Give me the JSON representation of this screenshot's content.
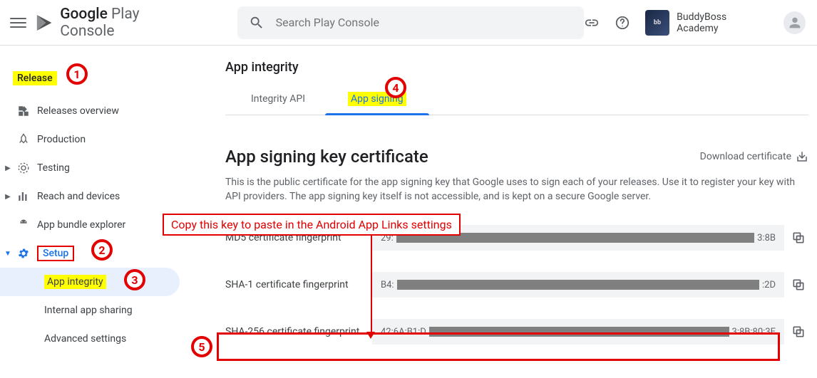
{
  "header": {
    "logo_google": "Google",
    "logo_play": " Play ",
    "logo_console": "Console",
    "search_placeholder": "Search Play Console",
    "account_name": "BuddyBoss Academy"
  },
  "sidebar": {
    "section": "Release",
    "items": [
      {
        "label": "Releases overview"
      },
      {
        "label": "Production"
      },
      {
        "label": "Testing"
      },
      {
        "label": "Reach and devices"
      },
      {
        "label": "App bundle explorer"
      },
      {
        "label": "Setup"
      }
    ],
    "sub": [
      {
        "label": "App integrity"
      },
      {
        "label": "Internal app sharing"
      },
      {
        "label": "Advanced settings"
      }
    ]
  },
  "main": {
    "page_title": "App integrity",
    "tabs": {
      "t1": "Integrity API",
      "t2": "App signing"
    },
    "section_heading": "App signing key certificate",
    "download_cert": "Download certificate",
    "section_desc": "This is the public certificate for the app signing key that Google uses to sign each of your releases. Use it to register your key with API providers. The app signing key itself is not accessible, and is kept on a secure Google server.",
    "rows": [
      {
        "label": "MD5 certificate fingerprint",
        "pre": "29:",
        "post": "3:8B"
      },
      {
        "label": "SHA-1 certificate fingerprint",
        "pre": "B4:",
        "post": ":2D"
      },
      {
        "label": "SHA-256 certificate fingerprint",
        "pre": "42:6A:B1:D",
        "post": "3:8B:80:3E"
      }
    ]
  },
  "annotations": {
    "n1": "1",
    "n2": "2",
    "n3": "3",
    "n4": "4",
    "n5": "5",
    "copy_hint": "Copy this key to paste in the Android App Links settings"
  }
}
